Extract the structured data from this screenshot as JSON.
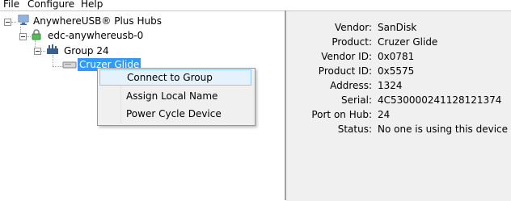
{
  "menu": {
    "file": "File",
    "configure": "Configure",
    "help": "Help"
  },
  "tree": {
    "root": "AnywhereUSB® Plus Hubs",
    "hub": "edc-anywhereusb-0",
    "group": "Group 24",
    "device": "Cruzer Glide"
  },
  "context_menu": {
    "items": [
      {
        "label": "Connect to Group"
      },
      {
        "label": "Assign Local Name"
      },
      {
        "label": "Power Cycle Device"
      }
    ]
  },
  "details": [
    {
      "label": "Vendor:",
      "value": "SanDisk"
    },
    {
      "label": "Product:",
      "value": "Cruzer Glide"
    },
    {
      "label": "Vendor ID:",
      "value": "0x0781"
    },
    {
      "label": "Product ID:",
      "value": "0x5575"
    },
    {
      "label": "Address:",
      "value": "1324"
    },
    {
      "label": "Serial:",
      "value": "4C530000241128121374"
    },
    {
      "label": "Port on Hub:",
      "value": "24"
    },
    {
      "label": "Status:",
      "value": "No one is using this device"
    }
  ]
}
